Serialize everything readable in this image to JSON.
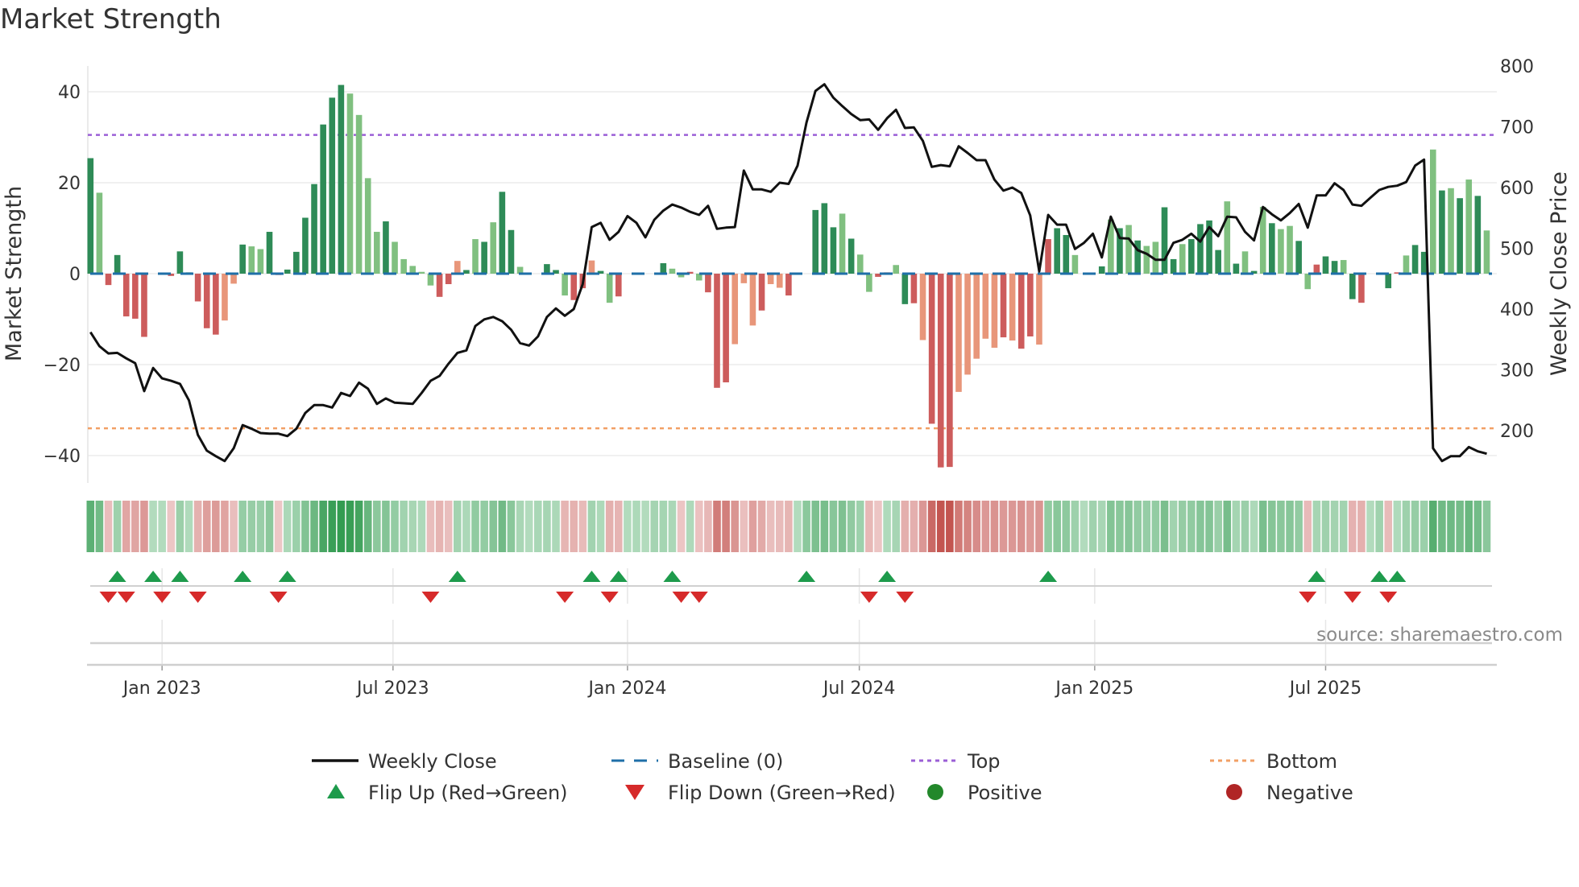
{
  "page": {
    "title": "Market Strength",
    "source": "source: sharemaestro.com"
  },
  "chart_data": {
    "type": "bar+line",
    "title": "Market Strength",
    "ylabel": "Market Strength",
    "y2label": "Weekly Close Price",
    "ylim": [
      -46,
      46
    ],
    "y2lim": [
      131,
      800
    ],
    "yticks": [
      40,
      20,
      0,
      -20,
      -40
    ],
    "ytick_labels": [
      "40",
      "20",
      "0",
      "−20",
      "−40"
    ],
    "y2ticks": [
      800,
      700,
      600,
      500,
      400,
      300,
      200
    ],
    "y2tick_labels": [
      "800",
      "700",
      "600",
      "500",
      "400",
      "300",
      "200"
    ],
    "x_start": "2022-11 (weekly)",
    "xticks": [
      {
        "label": "Jan 2023",
        "week": 8
      },
      {
        "label": "Jul 2023",
        "week": 33.8
      },
      {
        "label": "Jan 2024",
        "week": 60
      },
      {
        "label": "Jul 2024",
        "week": 85.9
      },
      {
        "label": "Jan 2025",
        "week": 112.2
      },
      {
        "label": "Jul 2025",
        "week": 138
      }
    ],
    "top_level": 30.5,
    "bottom_level": -34,
    "strength": [
      25.4,
      17.8,
      -2.5,
      4.1,
      -9.4,
      -9.9,
      -13.9,
      0,
      0,
      -0.5,
      4.9,
      0.3,
      -6.1,
      -12,
      -13.4,
      -10.3,
      -2.2,
      6.4,
      6.0,
      5.4,
      9.2,
      -0.3,
      0.9,
      4.8,
      12.3,
      19.7,
      32.8,
      38.7,
      41.5,
      39.6,
      34.9,
      21,
      9.2,
      11.5,
      7.0,
      3.2,
      1.7,
      0.4,
      -2.6,
      -5.1,
      -2.3,
      2.8,
      0.8,
      7.6,
      7.0,
      11.3,
      18,
      9.6,
      1.5,
      0,
      1.4,
      2.1,
      0.8,
      -4.8,
      -5.8,
      -3.2,
      2.9,
      0.6,
      -6.4,
      -5,
      0,
      0.6,
      0,
      2.4,
      2.3,
      1.1,
      -0.8,
      0.4,
      -1.5,
      -4.1,
      -25.1,
      -23.9,
      -15.5,
      -2.1,
      -11.4,
      -8.1,
      -2.3,
      -3.1,
      -4.8,
      0,
      9.3,
      14,
      15.5,
      10.2,
      13.2,
      7.7,
      4.2,
      -4.0,
      -0.7,
      0.3,
      1.9,
      -6.7,
      -6.5,
      -14.6,
      -33,
      -42.6,
      -42.5,
      -26,
      -22.2,
      -18.7,
      -14.3,
      -16.3,
      -14,
      -14.7,
      -16.5,
      -13.8,
      -15.6,
      7.6,
      10,
      8.5,
      4.1,
      0,
      3.5,
      1.6,
      11.9,
      10,
      10.7,
      7.3,
      6.1,
      7,
      14.6,
      3.2,
      6.5,
      7.6,
      10.9,
      11.7,
      5.2,
      15.9,
      2.2,
      4.9,
      0.6,
      14.7,
      11.1,
      9.8,
      10.5,
      7.2,
      -3.4,
      2,
      3.8,
      2.8,
      3,
      -5.6,
      -6.4,
      0,
      3.5,
      -3.2,
      0.3,
      4,
      6.3,
      4.8,
      27.3,
      18.3,
      18.8,
      16.6,
      20.7,
      17.1,
      9.5
    ],
    "shade": "GgRGRRRzzRGgRRRrrGggGRGGGGGGGggggGgggggRRrGgGgGGggzGGgRRrGgRrzGzGggRgRRRrrrRrrRRzGGGgGggRrgGRrRRRrrrrrRrRRrRGGggzGgGgGggGGgGGGGgGgGgGggGgRGGgGRRzGRgGGgGgGgGgg",
    "weekly_close": [
      362,
      339,
      327,
      328,
      319,
      311,
      265,
      303,
      286,
      282,
      277,
      250,
      193,
      167,
      158,
      150,
      171,
      209,
      203,
      196,
      195,
      195,
      191,
      203,
      229,
      242,
      242,
      238,
      262,
      257,
      279,
      269,
      244,
      253,
      246,
      245,
      244,
      262,
      282,
      290,
      310,
      328,
      332,
      372,
      383,
      387,
      380,
      366,
      344,
      340,
      355,
      387,
      401,
      389,
      400,
      441,
      535,
      542,
      514,
      527,
      553,
      542,
      518,
      547,
      562,
      572,
      567,
      560,
      555,
      570,
      532,
      534,
      535,
      628,
      597,
      597,
      593,
      608,
      606,
      636,
      707,
      759,
      770,
      748,
      734,
      721,
      711,
      712,
      695,
      714,
      728,
      698,
      699,
      677,
      634,
      637,
      635,
      668,
      657,
      645,
      645,
      613,
      595,
      600,
      591,
      554,
      462,
      555,
      539,
      539,
      499,
      509,
      524,
      485,
      552,
      517,
      516,
      497,
      491,
      481,
      481,
      509,
      514,
      524,
      511,
      535,
      520,
      552,
      551,
      527,
      513,
      568,
      556,
      546,
      558,
      573,
      534,
      587,
      587,
      607,
      596,
      572,
      570,
      583,
      596,
      601,
      603,
      609,
      636,
      646,
      171,
      150,
      158,
      158,
      173,
      166,
      162
    ],
    "flip_up_weeks": [
      3,
      7,
      10,
      17,
      22,
      41,
      56,
      59,
      65,
      80,
      89,
      107,
      137,
      144,
      146
    ],
    "flip_down_weeks": [
      2,
      4,
      8,
      12,
      21,
      38,
      53,
      58,
      66,
      68,
      87,
      91,
      136,
      141,
      145
    ],
    "legend": [
      {
        "label": "Weekly Close",
        "kind": "line",
        "color": "#111111"
      },
      {
        "label": "Baseline (0)",
        "kind": "dash",
        "color": "#1f6fa8"
      },
      {
        "label": "Top",
        "kind": "dot",
        "color": "#9b5fd6"
      },
      {
        "label": "Bottom",
        "kind": "dot",
        "color": "#f2a065"
      },
      {
        "label": "Flip Up (Red→Green)",
        "kind": "tri-up",
        "color": "#1e9b4c"
      },
      {
        "label": "Flip Down (Green→Red)",
        "kind": "tri-down",
        "color": "#d62a2a"
      },
      {
        "label": "Positive",
        "kind": "circle",
        "color": "#23882b"
      },
      {
        "label": "Negative",
        "kind": "circle",
        "color": "#b02525"
      }
    ],
    "legend_position": "bottom-center",
    "grid": true
  },
  "colors": {
    "dark_green": "#2e8b57",
    "light_green": "#80c080",
    "dark_red": "#cd5c5c",
    "light_red": "#e8967a",
    "top": "#9b5fd6",
    "bottom": "#f2a065",
    "baseline": "#1f6fa8"
  }
}
